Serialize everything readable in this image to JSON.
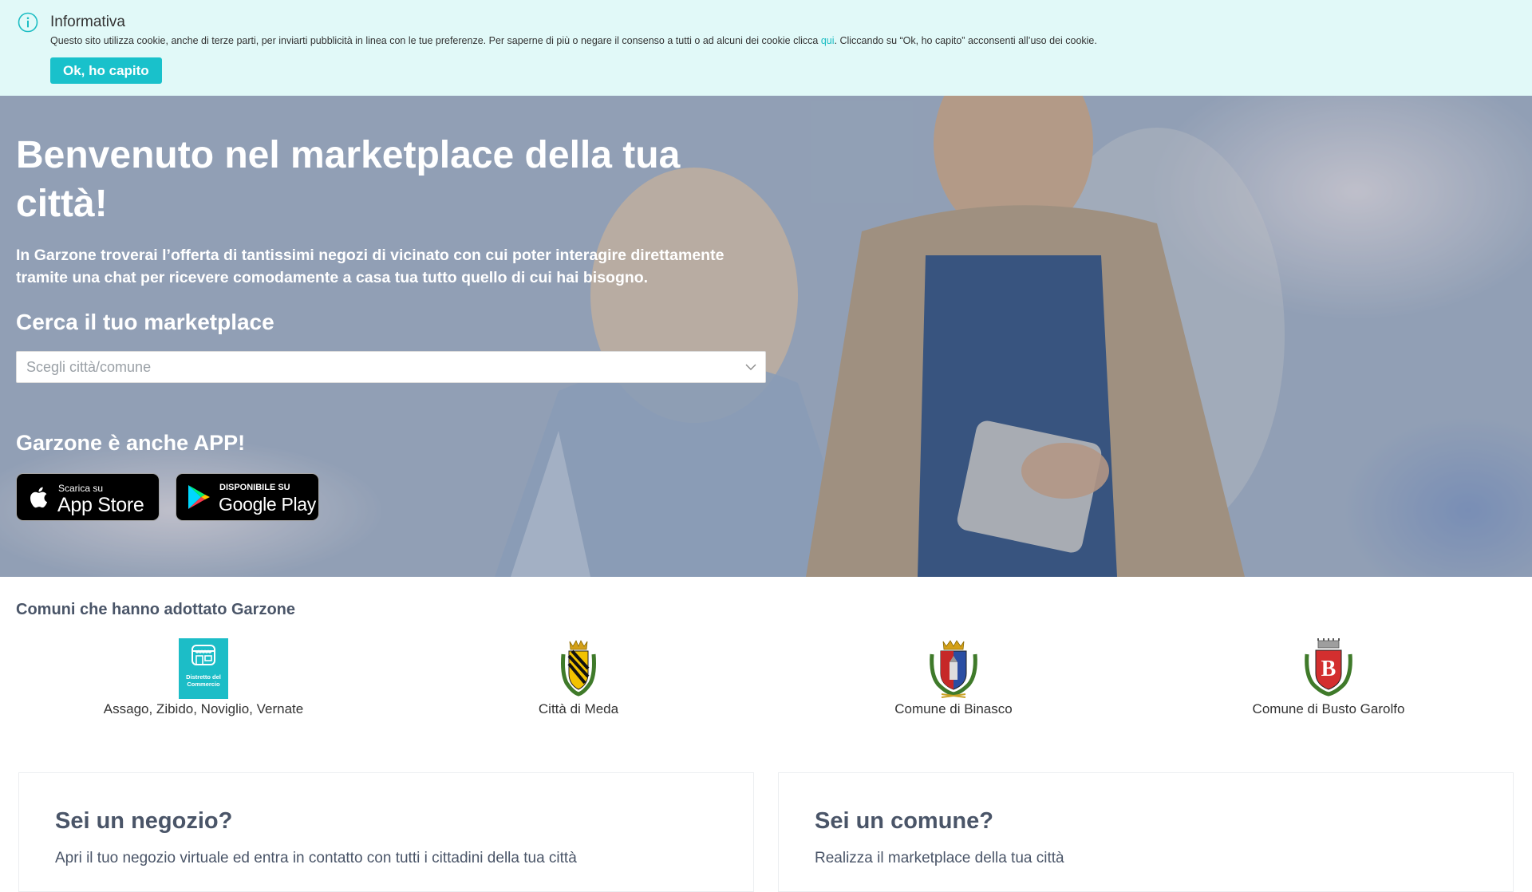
{
  "cookie": {
    "title": "Informativa",
    "text_before": "Questo sito utilizza cookie, anche di terze parti, per inviarti pubblicità in linea con le tue preferenze. Per saperne di più o negare il consenso a tutti o ad alcuni dei cookie clicca ",
    "link": "qui",
    "text_after": ". Cliccando su “Ok, ho capito” acconsenti all’uso dei cookie.",
    "ok_label": "Ok, ho capito",
    "icon": "info-icon",
    "accent_color": "#19c1cb"
  },
  "hero": {
    "title": "Benvenuto nel marketplace della tua città!",
    "lead": "In Garzone troverai l’offerta di tantissimi negozi di vicinato con cui poter interagire direttamente tramite una chat per ricevere comodamente a casa tua tutto quello di cui hai bisogno.",
    "search_title": "Cerca il tuo marketplace",
    "select_placeholder": "Scegli città/comune",
    "app_title": "Garzone è anche APP!",
    "appstore": {
      "small": "Scarica su",
      "big": "App Store",
      "icon": "apple-icon"
    },
    "googleplay": {
      "small": "DISPONIBILE SU",
      "big": "Google Play",
      "icon": "google-play-icon"
    }
  },
  "comuni": {
    "title": "Comuni che hanno adottato Garzone",
    "items": [
      {
        "label": "Assago, Zibido, Noviglio, Vernate",
        "logo_text": "Distretto del Commercio"
      },
      {
        "label": "Città di Meda"
      },
      {
        "label": "Comune di Binasco"
      },
      {
        "label": "Comune di Busto Garolfo",
        "logo_letter": "B"
      }
    ]
  },
  "cards": {
    "shop": {
      "title": "Sei un negozio?",
      "text": "Apri il tuo negozio virtuale ed entra in contatto con tutti i cittadini della tua città"
    },
    "comune": {
      "title": "Sei un comune?",
      "text": "Realizza il marketplace della tua città"
    }
  }
}
